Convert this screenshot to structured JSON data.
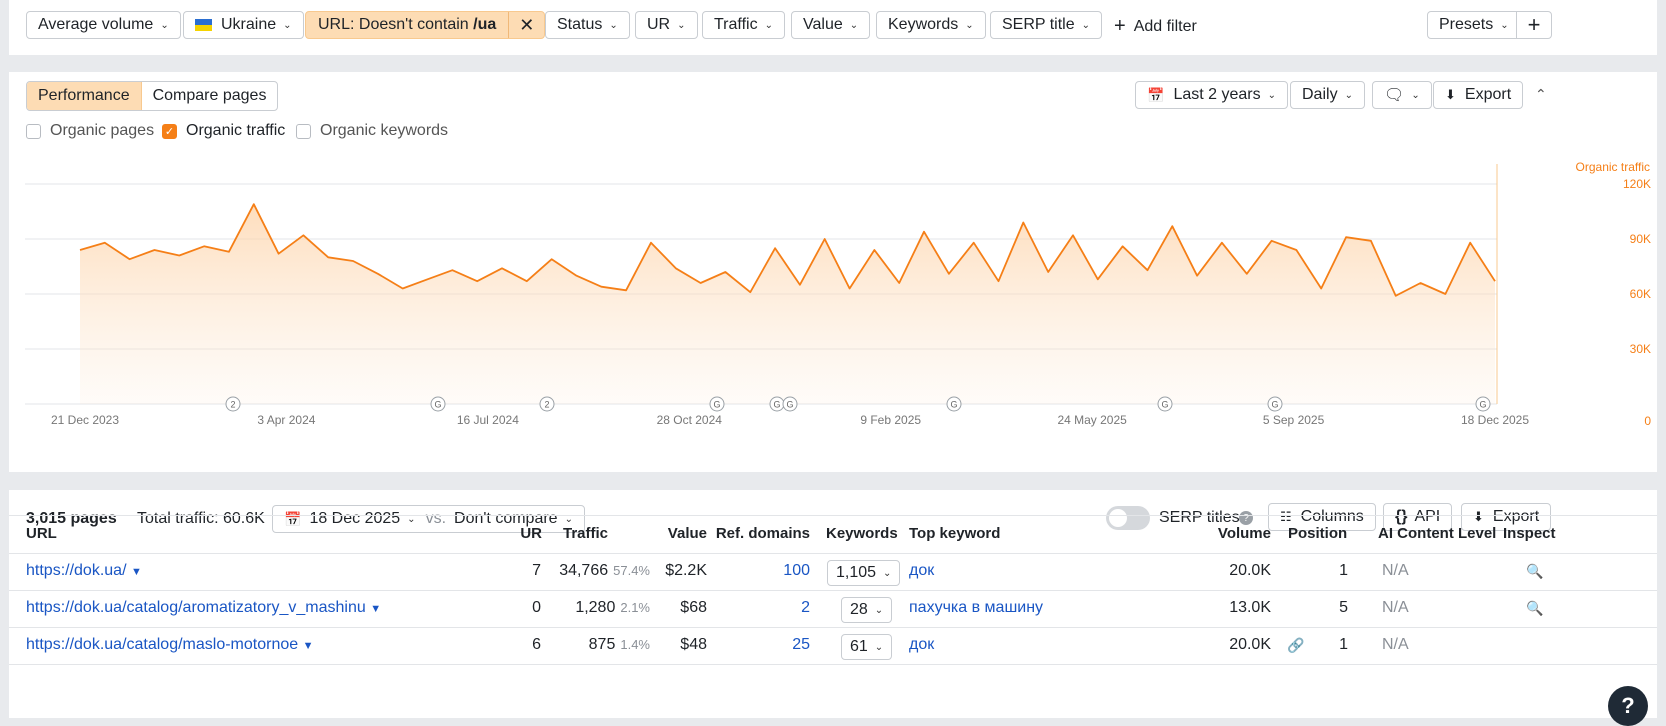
{
  "filters": {
    "volume": "Average volume",
    "country": "Ukraine",
    "url_filter_prefix": "URL: Doesn't contain ",
    "url_filter_value": "/ua",
    "status": "Status",
    "ur": "UR",
    "traffic": "Traffic",
    "value": "Value",
    "keywords": "Keywords",
    "serp_title": "SERP title",
    "add_filter": "Add filter",
    "presets": "Presets"
  },
  "performance": {
    "tabs": [
      "Performance",
      "Compare pages"
    ],
    "period": "Last 2 years",
    "interval": "Daily",
    "export": "Export",
    "checkboxes": [
      {
        "label": "Organic pages",
        "checked": false
      },
      {
        "label": "Organic traffic",
        "checked": true
      },
      {
        "label": "Organic keywords",
        "checked": false
      }
    ],
    "series_label": "Organic traffic"
  },
  "chart_data": {
    "type": "area",
    "series": [
      {
        "name": "Organic traffic",
        "color": "#f57f17"
      }
    ],
    "x_ticks": [
      "21 Dec 2023",
      "3 Apr 2024",
      "16 Jul 2024",
      "28 Oct 2024",
      "9 Feb 2025",
      "24 May 2025",
      "5 Sep 2025",
      "18 Dec 2025"
    ],
    "y_ticks": [
      "0",
      "30K",
      "60K",
      "90K",
      "120K"
    ],
    "ylim": [
      0,
      120000
    ],
    "grid": true,
    "markers": [
      "2",
      "G",
      "2",
      "G",
      "G",
      "G",
      "G",
      "G",
      "G",
      "G"
    ],
    "approx_values": [
      84000,
      88000,
      79000,
      84000,
      81000,
      86000,
      83000,
      109000,
      82000,
      92000,
      80000,
      78000,
      71000,
      63000,
      68000,
      73000,
      67000,
      74000,
      67000,
      79000,
      70000,
      64000,
      62000,
      88000,
      74000,
      66000,
      72000,
      61000,
      85000,
      65000,
      90000,
      63000,
      84000,
      66000,
      94000,
      71000,
      88000,
      67000,
      99000,
      72000,
      92000,
      68000,
      86000,
      73000,
      97000,
      70000,
      88000,
      71000,
      89000,
      84000,
      63000,
      91000,
      89000,
      59000,
      66000,
      60000,
      88000,
      67000
    ]
  },
  "table": {
    "pages_count": "3,015 pages",
    "total_traffic": "Total traffic: 60.6K",
    "date": "18 Dec 2025",
    "vs": "vs.",
    "compare": "Don't compare",
    "serp_titles": "SERP titles",
    "columns": "Columns",
    "api": "API",
    "export": "Export",
    "headers": {
      "url": "URL",
      "ur": "UR",
      "traffic": "Traffic",
      "value": "Value",
      "ref_domains": "Ref. domains",
      "keywords": "Keywords",
      "top_keyword": "Top keyword",
      "volume": "Volume",
      "position": "Position",
      "ai": "AI Content Level",
      "inspect": "Inspect"
    },
    "rows": [
      {
        "url": "https://dok.ua/",
        "ur": "7",
        "traffic": "34,766",
        "share": "57.4%",
        "value": "$2.2K",
        "ref_domains": "100",
        "keywords": "1,105",
        "top_keyword": "док",
        "volume": "20.0K",
        "position": "1",
        "ai": "N/A"
      },
      {
        "url": "https://dok.ua/catalog/aromatizatory_v_mashinu",
        "ur": "0",
        "traffic": "1,280",
        "share": "2.1%",
        "value": "$68",
        "ref_domains": "2",
        "keywords": "28",
        "top_keyword": "пахучка в машину",
        "volume": "13.0K",
        "position": "5",
        "ai": "N/A"
      },
      {
        "url": "https://dok.ua/catalog/maslo-motornoe",
        "ur": "6",
        "traffic": "875",
        "share": "1.4%",
        "value": "$48",
        "ref_domains": "25",
        "keywords": "61",
        "top_keyword": "док",
        "volume": "20.0K",
        "position": "1",
        "ai": "N/A"
      }
    ]
  }
}
